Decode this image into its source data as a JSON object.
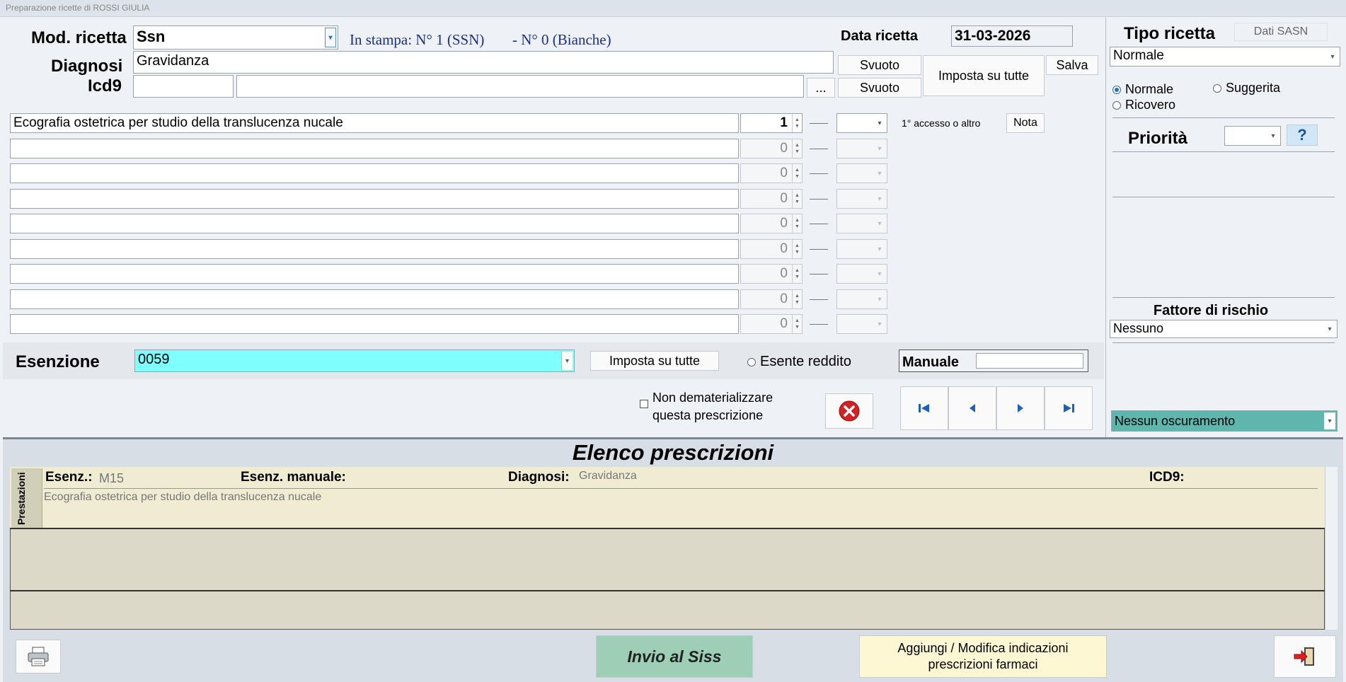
{
  "window": {
    "title": "Preparazione ricette di ROSSI GIULIA"
  },
  "header": {
    "mod_ricetta_label": "Mod. ricetta",
    "mod_ricetta_value": "Ssn",
    "in_stampa": "In stampa: N° 1 (SSN)",
    "bianche": "- N° 0 (Bianche)",
    "data_ricetta_label": "Data ricetta",
    "data_ricetta_value": "31-03-2026",
    "diagnosi_label": "Diagnosi",
    "diagnosi_value": "Gravidanza",
    "icd9_label": "Icd9",
    "icd9_code": "",
    "icd9_desc": "",
    "svuoto_label": "Svuoto",
    "svuoto2_label": "Svuoto",
    "dots_label": "...",
    "imposta_su_tutte_label": "Imposta su tutte",
    "salva_label": "Salva"
  },
  "prestazioni": {
    "rows": [
      {
        "text": "Ecografia ostetrica per studio della translucenza nucale",
        "qty": "1",
        "active": true
      },
      {
        "text": "",
        "qty": "0",
        "active": false
      },
      {
        "text": "",
        "qty": "0",
        "active": false
      },
      {
        "text": "",
        "qty": "0",
        "active": false
      },
      {
        "text": "",
        "qty": "0",
        "active": false
      },
      {
        "text": "",
        "qty": "0",
        "active": false
      },
      {
        "text": "",
        "qty": "0",
        "active": false
      },
      {
        "text": "",
        "qty": "0",
        "active": false
      },
      {
        "text": "",
        "qty": "0",
        "active": false
      }
    ],
    "accesso_label": "1° accesso o altro",
    "nota_label": "Nota"
  },
  "esenzione": {
    "label": "Esenzione",
    "value": "0059",
    "imposta_label": "Imposta su tutte",
    "esente_reddito_label": "Esente reddito",
    "manuale_label": "Manuale",
    "manuale_value": ""
  },
  "demat": {
    "line1": "Non dematerializzare",
    "line2": "questa prescrizione"
  },
  "right": {
    "tipo_ricetta_label": "Tipo ricetta",
    "dati_sasn_label": "Dati SASN",
    "tipo_value": "Normale",
    "radio_normale": "Normale",
    "radio_suggerita": "Suggerita",
    "radio_ricovero": "Ricovero",
    "priorita_label": "Priorità",
    "priorita_value": "",
    "help_label": "?",
    "fattore_label": "Fattore di rischio",
    "fattore_value": "Nessuno",
    "oscuramento_value": "Nessun oscuramento"
  },
  "elenco": {
    "title": "Elenco prescrizioni",
    "tab_label": "Prestazioni",
    "esenz_label": "Esenz.:",
    "esenz_value": "M15",
    "esenz_manuale_label": "Esenz. manuale:",
    "diagnosi_label": "Diagnosi:",
    "diagnosi_value": "Gravidanza",
    "icd9_label": "ICD9:",
    "item_text": "Ecografia ostetrica per studio della translucenza nucale"
  },
  "footer": {
    "invio_label": "Invio al Siss",
    "aggiungi_line1": "Aggiungi / Modifica indicazioni",
    "aggiungi_line2": "prescrizioni farmaci"
  },
  "colors": {
    "esenzione_bg": "#80ffff",
    "oscuramento_bg": "#5fb6ad",
    "invio_bg": "#9ccfb6",
    "aggiungi_bg": "#fdf7d3",
    "text_blue": "#1c2e8c"
  },
  "icons": {
    "printer": "printer-icon",
    "close": "close-icon",
    "exit": "exit-icon",
    "nav_first": "first-record-icon",
    "nav_prev": "previous-record-icon",
    "nav_next": "next-record-icon",
    "nav_last": "last-record-icon"
  }
}
